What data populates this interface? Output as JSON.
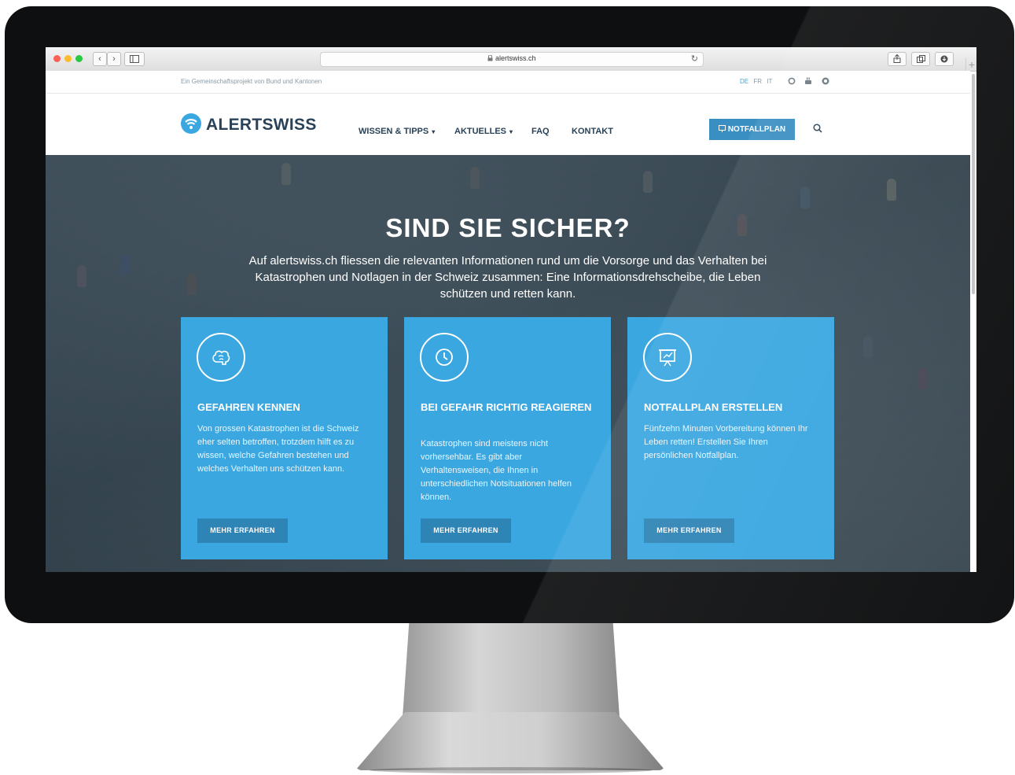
{
  "browser": {
    "url": "alertswiss.ch",
    "back_icon": "‹",
    "forward_icon": "›"
  },
  "topbar": {
    "tagline": "Ein Gemeinschaftsprojekt von Bund und Kantonen",
    "languages": [
      "DE",
      "FR",
      "IT"
    ],
    "active_language": "DE"
  },
  "logo": {
    "part1": "ALERT",
    "part2": "SWISS"
  },
  "nav": {
    "items": [
      {
        "label": "WISSEN & TIPPS",
        "dropdown": true
      },
      {
        "label": "AKTUELLES",
        "dropdown": true
      },
      {
        "label": "FAQ",
        "dropdown": false
      },
      {
        "label": "KONTAKT",
        "dropdown": false
      }
    ],
    "cta_label": "NOTFALLPLAN"
  },
  "hero": {
    "title": "SIND SIE SICHER?",
    "text": "Auf alertswiss.ch fliessen die relevanten Informationen rund um die Vorsorge und das Verhalten bei Katastrophen und Notlagen in der Schweiz zusammen: Eine Informationsdrehscheibe, die Leben schützen und retten kann."
  },
  "cards": [
    {
      "icon": "brain-icon",
      "title": "GEFAHREN KENNEN",
      "text": "Von grossen Katastrophen ist die Schweiz eher selten betroffen, trotzdem hilft es zu wissen, welche Gefahren bestehen und welches Verhalten uns schützen kann.",
      "button": "MEHR ERFAHREN"
    },
    {
      "icon": "clock-icon",
      "title": "BEI GEFAHR RICHTIG REAGIEREN",
      "text": "Katastrophen sind meistens nicht vorhersehbar. Es gibt aber Verhaltensweisen, die Ihnen in unterschiedlichen Notsituationen helfen können.",
      "button": "MEHR ERFAHREN"
    },
    {
      "icon": "presentation-board-icon",
      "title": "NOTFALLPLAN ERSTELLEN",
      "text": "Fünfzehn Minuten Vorbereitung können Ihr Leben retten! Erstellen Sie Ihren persönlichen Notfallplan.",
      "button": "MEHR ERFAHREN"
    }
  ],
  "colors": {
    "brand_blue": "#3aa7e0",
    "navy": "#2a4257",
    "button_blue": "#2f84b6"
  }
}
